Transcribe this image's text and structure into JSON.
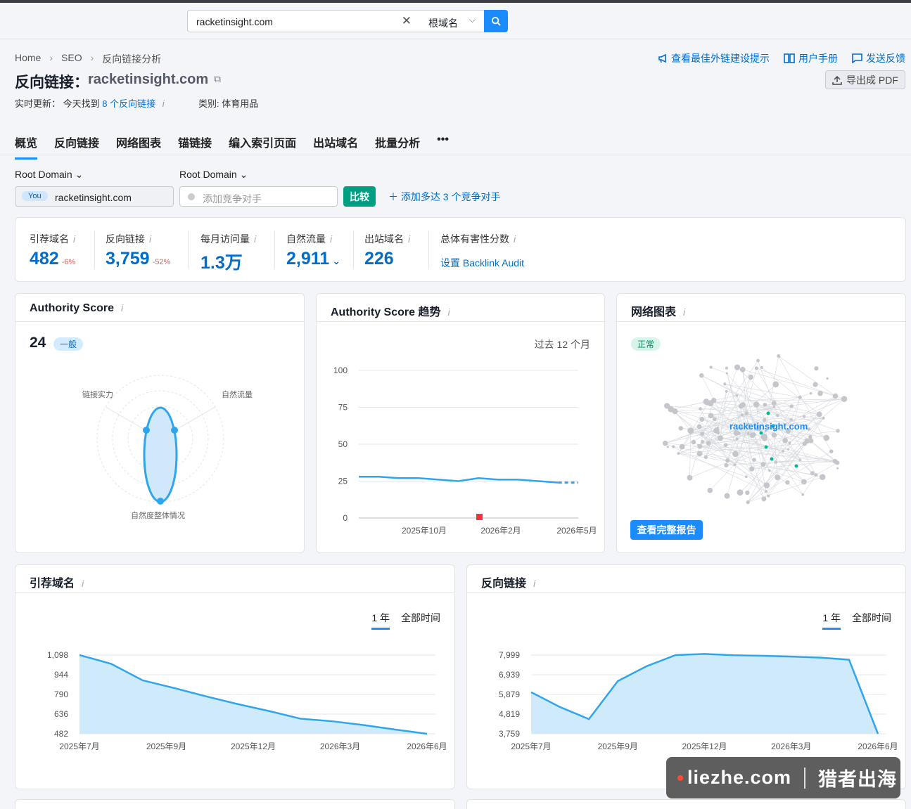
{
  "search": {
    "value": "racketinsight.com",
    "scope": "根域名"
  },
  "breadcrumb": [
    "Home",
    "SEO",
    "反向链接分析"
  ],
  "title": {
    "label": "反向链接：",
    "domain": "racketinsight.com"
  },
  "status": {
    "prefix": "实时更新：",
    "today": "今天找到",
    "link": "8 个反向链接",
    "category": "类别: 体育用品"
  },
  "toplinks": [
    "查看最佳外链建设提示",
    "用户手册",
    "发送反馈"
  ],
  "export_label": "导出成 PDF",
  "tabs": [
    "概览",
    "反向链接",
    "网络图表",
    "锚链接",
    "编入索引页面",
    "出站域名",
    "批量分析",
    "•••"
  ],
  "filters": {
    "root_domain_1": "Root Domain",
    "root_domain_2": "Root Domain",
    "you_badge": "You",
    "you_domain": "racketinsight.com",
    "competitor_placeholder": "添加竞争对手",
    "compare": "比较",
    "add_competitors": "添加多达 3 个竞争对手"
  },
  "metrics": [
    {
      "label": "引荐域名",
      "value": "482",
      "delta": "-6%"
    },
    {
      "label": "反向链接",
      "value": "3,759",
      "delta": "-52%"
    },
    {
      "label": "每月访问量",
      "value": "1.3万",
      "delta": ""
    },
    {
      "label": "自然流量",
      "value": "2,911",
      "delta": ""
    },
    {
      "label": "出站域名",
      "value": "226",
      "delta": ""
    },
    {
      "label": "总体有害性分数",
      "value": "",
      "link": "设置 Backlink Audit"
    }
  ],
  "authority_card": {
    "title": "Authority Score",
    "score": "24",
    "badge": "一般",
    "radar_labels": [
      "链接实力",
      "自然流量",
      "自然度整体情况"
    ]
  },
  "trend_card": {
    "title": "Authority Score 趋势",
    "period": "过去 12 个月"
  },
  "network_card": {
    "title": "网络图表",
    "badge": "正常",
    "center_label": "racketinsight.com",
    "button": "查看完整报告"
  },
  "ref_card": {
    "title": "引荐域名",
    "range_1y": "1 年",
    "range_all": "全部时间"
  },
  "bl_card": {
    "title": "反向链接",
    "range_1y": "1 年",
    "range_all": "全部时间"
  },
  "watermark": {
    "left": "liezhe.com",
    "right": "猎者出海"
  },
  "chart_data": [
    {
      "type": "line",
      "title": "Authority Score 趋势",
      "x_ticks": [
        "2025年10月",
        "2026年2月",
        "2026年5月"
      ],
      "y_ticks": [
        100,
        75,
        50,
        25,
        0
      ],
      "ylim": [
        0,
        100
      ],
      "series": [
        {
          "values": [
            28,
            28,
            27,
            27,
            26,
            25,
            27,
            26,
            26,
            25,
            24,
            24
          ]
        }
      ]
    },
    {
      "type": "area",
      "title": "引荐域名",
      "x_ticks": [
        "2025年7月",
        "2025年9月",
        "2025年12月",
        "2026年3月",
        "2026年6月"
      ],
      "y_ticks": [
        1098,
        944,
        790,
        636,
        482
      ],
      "ylim": [
        482,
        1098
      ],
      "series": [
        {
          "values": [
            1098,
            1030,
            900,
            840,
            775,
            715,
            660,
            600,
            580,
            550,
            515,
            482
          ]
        }
      ]
    },
    {
      "type": "area",
      "title": "反向链接",
      "x_ticks": [
        "2025年7月",
        "2025年9月",
        "2025年12月",
        "2026年3月",
        "2026年6月"
      ],
      "y_ticks": [
        7999,
        6939,
        5879,
        4819,
        3759
      ],
      "ylim": [
        3759,
        7999
      ],
      "series": [
        {
          "values": [
            6000,
            5200,
            4550,
            6600,
            7400,
            8000,
            8060,
            7990,
            7960,
            7920,
            7860,
            7750,
            3759
          ]
        }
      ]
    }
  ]
}
